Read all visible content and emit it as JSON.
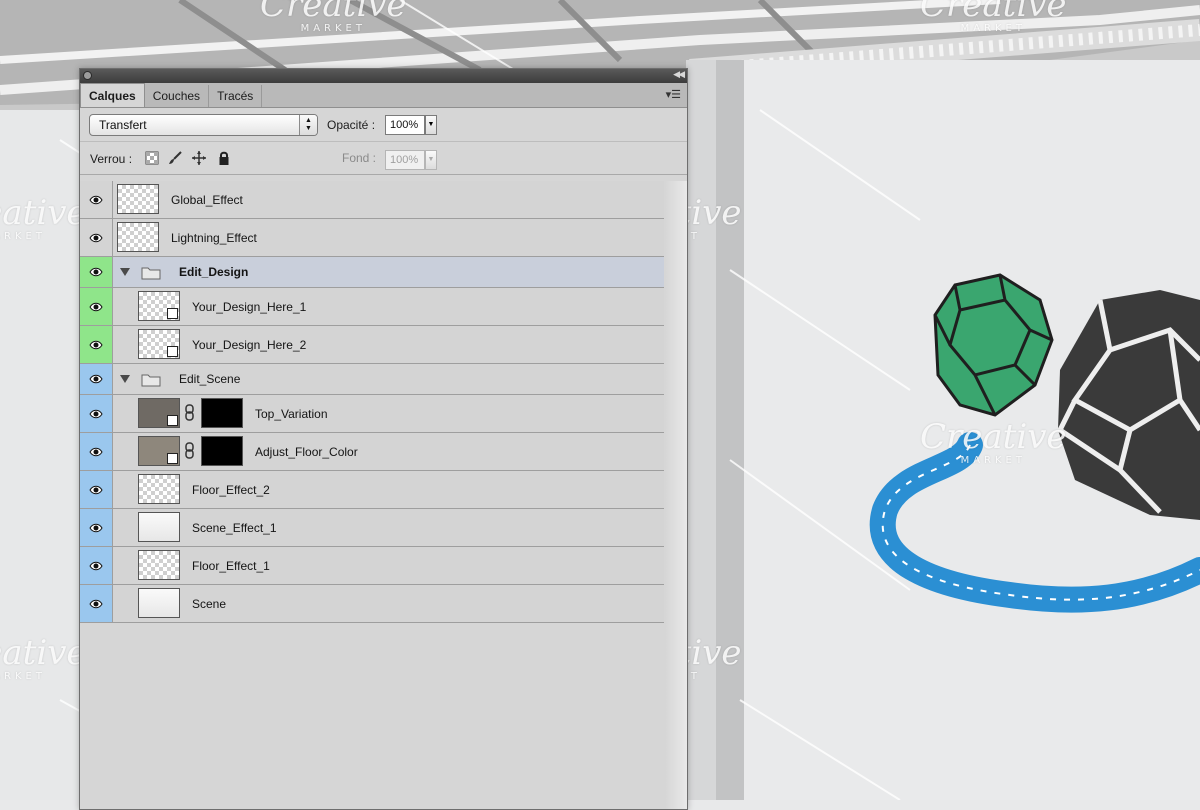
{
  "panel": {
    "tabs": [
      {
        "label": "Calques",
        "active": true
      },
      {
        "label": "Couches",
        "active": false
      },
      {
        "label": "Tracés",
        "active": false
      }
    ],
    "blend_mode": "Transfert",
    "opacity_label": "Opacité :",
    "opacity_value": "100%",
    "lock_label": "Verrou :",
    "fill_label": "Fond :",
    "fill_value": "100%"
  },
  "layers": [
    {
      "name": "Global_Effect",
      "type": "layer",
      "eye": "none"
    },
    {
      "name": "Lightning_Effect",
      "type": "layer",
      "eye": "none"
    },
    {
      "name": "Edit_Design",
      "type": "group",
      "eye": "green",
      "selected": true
    },
    {
      "name": "Your_Design_Here_1",
      "type": "smart",
      "eye": "green"
    },
    {
      "name": "Your_Design_Here_2",
      "type": "smart",
      "eye": "green"
    },
    {
      "name": "Edit_Scene",
      "type": "group",
      "eye": "blue"
    },
    {
      "name": "Top_Variation",
      "type": "adjust",
      "eye": "blue"
    },
    {
      "name": "Adjust_Floor_Color",
      "type": "adjust",
      "eye": "blue"
    },
    {
      "name": "Floor_Effect_2",
      "type": "layer",
      "eye": "blue"
    },
    {
      "name": "Scene_Effect_1",
      "type": "layer",
      "eye": "blue"
    },
    {
      "name": "Floor_Effect_1",
      "type": "layer",
      "eye": "blue"
    },
    {
      "name": "Scene",
      "type": "layer",
      "eye": "blue"
    }
  ],
  "watermark": {
    "title": "Creative",
    "subtitle": "MARKET"
  },
  "colors": {
    "green_label": "#8fe58a",
    "blue_label": "#9ac7ee",
    "gem_green": "#3aa66f",
    "gem_dark": "#3a3a3a",
    "rope_blue": "#2b8fd3"
  }
}
